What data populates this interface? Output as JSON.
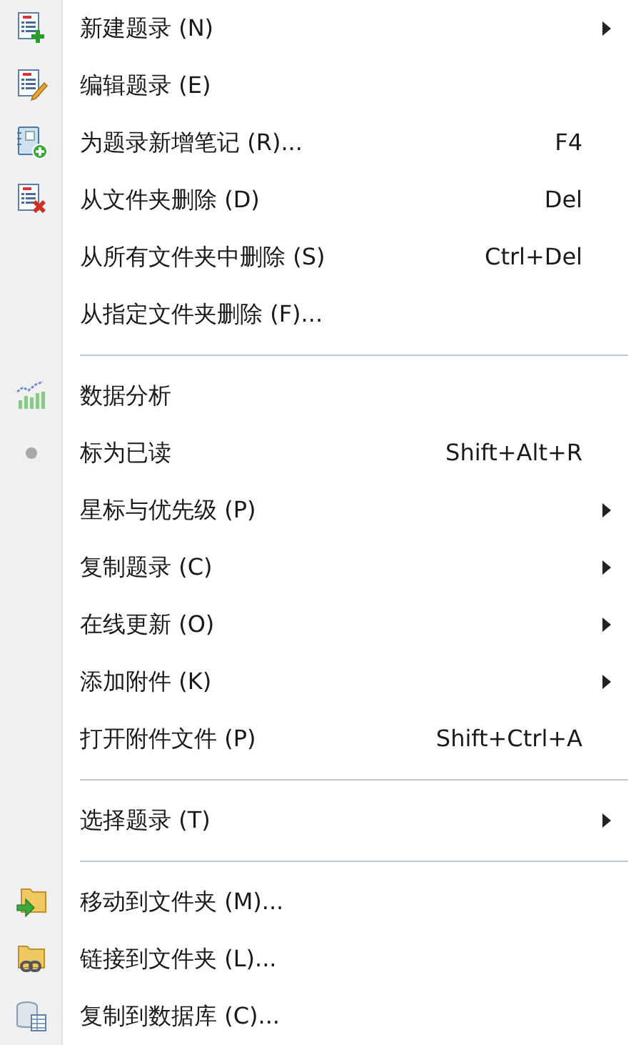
{
  "menu": {
    "sections": [
      {
        "items": [
          {
            "label": "新建题录 (N)",
            "submenu": true
          },
          {
            "label": "编辑题录 (E)",
            "submenu": false
          },
          {
            "label": "为题录新增笔记 (R)...",
            "shortcut": "F4",
            "submenu": false
          },
          {
            "label": "从文件夹删除 (D)",
            "shortcut": "Del",
            "submenu": false
          },
          {
            "label": "从所有文件夹中删除 (S)",
            "shortcut": "Ctrl+Del",
            "submenu": false
          },
          {
            "label": "从指定文件夹删除 (F)...",
            "submenu": false
          }
        ]
      },
      {
        "items": [
          {
            "label": "数据分析",
            "submenu": false
          },
          {
            "label": "标为已读",
            "shortcut": "Shift+Alt+R",
            "submenu": false
          },
          {
            "label": "星标与优先级 (P)",
            "submenu": true
          },
          {
            "label": "复制题录 (C)",
            "submenu": true
          },
          {
            "label": "在线更新 (O)",
            "submenu": true
          },
          {
            "label": "添加附件 (K)",
            "submenu": true
          },
          {
            "label": "打开附件文件 (P)",
            "shortcut": "Shift+Ctrl+A",
            "submenu": false
          }
        ]
      },
      {
        "items": [
          {
            "label": "选择题录 (T)",
            "submenu": true
          }
        ]
      },
      {
        "items": [
          {
            "label": "移动到文件夹 (M)...",
            "submenu": false
          },
          {
            "label": "链接到文件夹 (L)...",
            "submenu": false
          },
          {
            "label": "复制到数据库 (C)...",
            "submenu": false
          }
        ]
      }
    ]
  }
}
